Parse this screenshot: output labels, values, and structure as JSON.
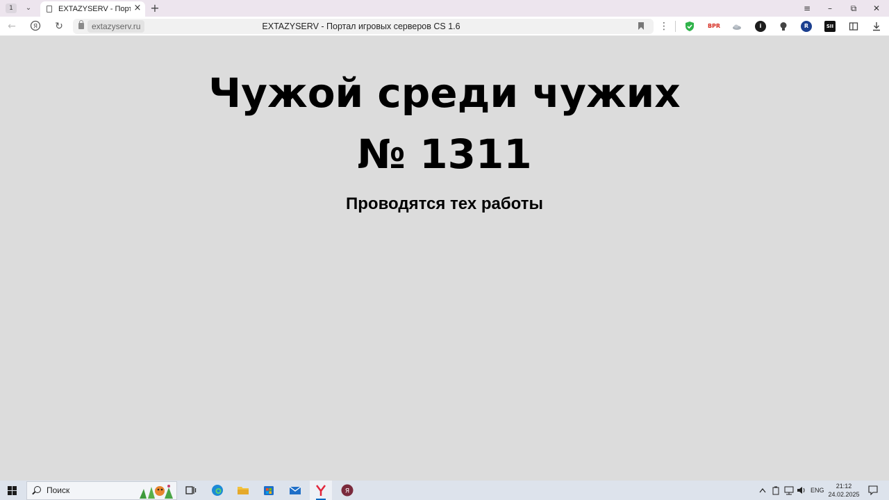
{
  "browser": {
    "tab_count": "1",
    "active_tab_title": "EXTAZYSERV - Портал",
    "address_domain": "extazyserv.ru",
    "page_title": "EXTAZYSERV - Портал игровых серверов CS 1.6",
    "extensions": [
      "shield-check",
      "bpr",
      "cloud",
      "info",
      "lightbulb",
      "r-logo",
      "sii",
      "downloads-stack"
    ]
  },
  "page": {
    "heading_line1": "Чужой среди чужих",
    "heading_line2": "№ 1311",
    "subheading": "Проводятся тех работы"
  },
  "taskbar": {
    "search_placeholder": "Поиск",
    "language": "ENG",
    "time": "21:12",
    "date": "24.02.2025"
  },
  "colors": {
    "page_bg": "#dcdcdc",
    "tab_strip_bg": "#ede5ee",
    "taskbar_bg": "#dde3ec",
    "accent": "#0067c0"
  }
}
